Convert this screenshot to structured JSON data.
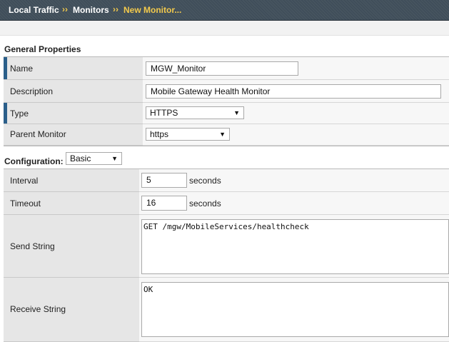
{
  "breadcrumb": {
    "items": [
      "Local Traffic",
      "Monitors",
      "New Monitor..."
    ],
    "separator": "››"
  },
  "general": {
    "title": "General Properties",
    "name": {
      "label": "Name",
      "value": "MGW_Monitor"
    },
    "description": {
      "label": "Description",
      "value": "Mobile Gateway Health Monitor"
    },
    "type": {
      "label": "Type",
      "value": "HTTPS"
    },
    "parent": {
      "label": "Parent Monitor",
      "value": "https"
    }
  },
  "configuration": {
    "title": "Configuration:",
    "mode": "Basic",
    "interval": {
      "label": "Interval",
      "value": "5",
      "unit": "seconds"
    },
    "timeout": {
      "label": "Timeout",
      "value": "16",
      "unit": "seconds"
    },
    "send": {
      "label": "Send String",
      "value": "GET /mgw/MobileServices/healthcheck"
    },
    "receive": {
      "label": "Receive String",
      "value": "OK"
    }
  },
  "colors": {
    "header_bg": "#3d4b58",
    "crumb_active": "#f2c94c",
    "required_marker": "#2b5f8a"
  },
  "icons": {
    "dropdown": "▼"
  }
}
